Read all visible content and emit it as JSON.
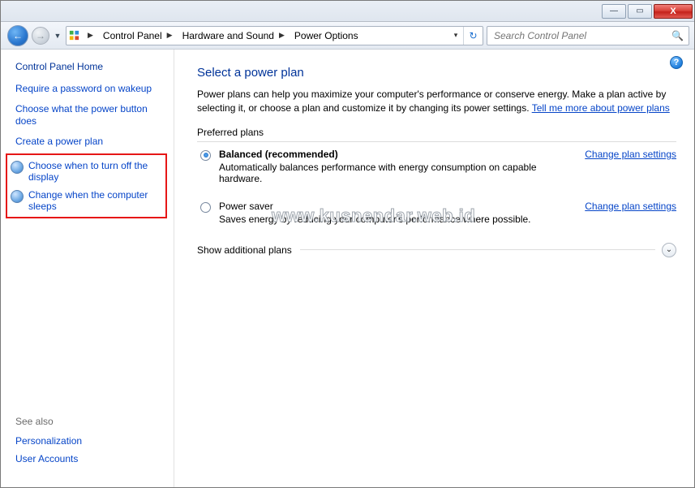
{
  "window": {
    "min_glyph": "—",
    "max_glyph": "▭",
    "close_glyph": "X"
  },
  "nav": {
    "back_glyph": "←",
    "fwd_glyph": "→",
    "drop_glyph": "▼",
    "refresh_glyph": "↻",
    "addr_drop_glyph": "▾"
  },
  "breadcrumb": {
    "items": [
      "Control Panel",
      "Hardware and Sound",
      "Power Options"
    ]
  },
  "search": {
    "placeholder": "Search Control Panel",
    "icon_glyph": "🔍"
  },
  "sidebar": {
    "home": "Control Panel Home",
    "links": [
      "Require a password on wakeup",
      "Choose what the power button does",
      "Create a power plan"
    ],
    "highlight": [
      "Choose when to turn off the display",
      "Change when the computer sleeps"
    ],
    "seealso_label": "See also",
    "seealso": [
      "Personalization",
      "User Accounts"
    ]
  },
  "main": {
    "help_glyph": "?",
    "title": "Select a power plan",
    "desc_a": "Power plans can help you maximize your computer's performance or conserve energy. Make a plan active by selecting it, or choose a plan and customize it by changing its power settings. ",
    "desc_link": "Tell me more about power plans",
    "preferred_label": "Preferred plans",
    "plans": [
      {
        "name": "Balanced (recommended)",
        "sub": "Automatically balances performance with energy consumption on capable hardware.",
        "change": "Change plan settings",
        "selected": true
      },
      {
        "name": "Power saver",
        "sub": "Saves energy by reducing your computer's performance where possible.",
        "change": "Change plan settings",
        "selected": false
      }
    ],
    "show_more": "Show additional plans",
    "expand_glyph": "⌄"
  },
  "watermark": "www.kusnendar.web.id"
}
